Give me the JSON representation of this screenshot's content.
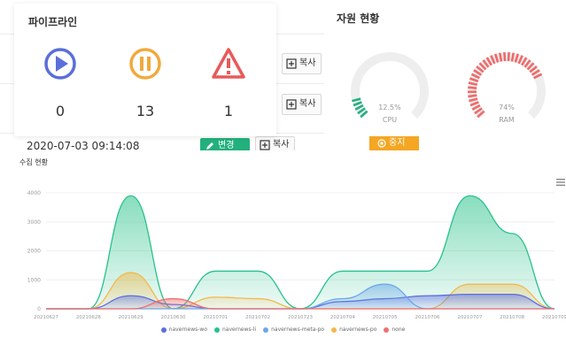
{
  "list": {
    "copy_label": "복사",
    "date": "2020-07-03 09:14:08",
    "edit_label": "변경"
  },
  "pipeline": {
    "title": "파이프라인",
    "running": {
      "count": "0",
      "icon": "play-icon",
      "color": "#5a6fd8"
    },
    "paused": {
      "count": "13",
      "icon": "pause-icon",
      "color": "#f2a93b"
    },
    "error": {
      "count": "1",
      "icon": "warning-icon",
      "color": "#e85a5a"
    }
  },
  "resource": {
    "title": "자원 현황",
    "cpu": {
      "label": "CPU",
      "value": "12.5%",
      "percent": 12.5,
      "color": "#23b07d"
    },
    "ram": {
      "label": "RAM",
      "value": "74%",
      "percent": 74,
      "color": "#f06a6a"
    },
    "stop_label": "중지"
  },
  "collection": {
    "title": "수집 현황"
  },
  "chart_data": {
    "type": "area",
    "x": [
      "20210627",
      "20210628",
      "20210629",
      "20210630",
      "20210701",
      "20210702",
      "20210723",
      "20210704",
      "20210705",
      "20210706",
      "20210707",
      "20210708",
      "20210709"
    ],
    "ylim": [
      0,
      4000
    ],
    "yticks": [
      "0",
      "1000",
      "2000",
      "3000",
      "4000"
    ],
    "series": [
      {
        "name": "navernews-wo",
        "color": "#5b6ee1",
        "values": [
          0,
          0,
          450,
          150,
          0,
          0,
          0,
          250,
          350,
          450,
          500,
          500,
          0
        ]
      },
      {
        "name": "navernews-li",
        "color": "#27c28a",
        "values": [
          0,
          0,
          3900,
          0,
          1300,
          1300,
          0,
          1300,
          1300,
          1300,
          3900,
          2600,
          0
        ]
      },
      {
        "name": "navernews-meta-po",
        "color": "#6aa8e8",
        "values": [
          0,
          0,
          0,
          0,
          0,
          0,
          0,
          350,
          850,
          0,
          0,
          0,
          0
        ]
      },
      {
        "name": "navernews-po",
        "color": "#f2b94e",
        "values": [
          0,
          0,
          1250,
          0,
          400,
          350,
          0,
          0,
          0,
          0,
          850,
          850,
          0
        ]
      },
      {
        "name": "none",
        "color": "#f07070",
        "values": [
          0,
          0,
          0,
          350,
          0,
          0,
          0,
          0,
          0,
          0,
          0,
          0,
          0
        ]
      }
    ]
  }
}
